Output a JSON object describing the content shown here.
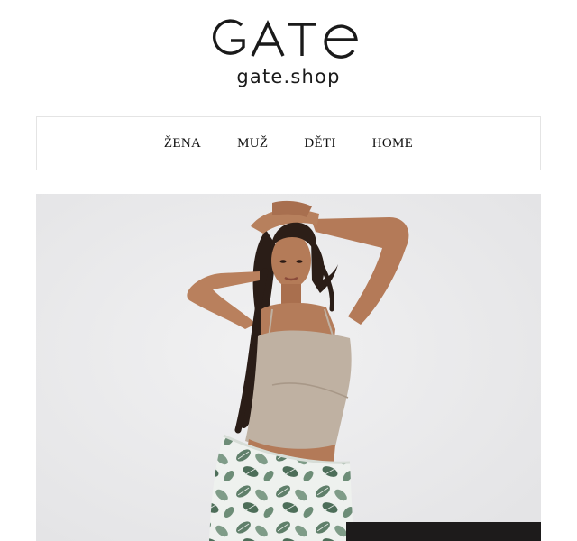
{
  "brand": {
    "logo_text": "GATE",
    "domain": "gate.shop"
  },
  "nav": {
    "items": [
      {
        "label": "ŽENA"
      },
      {
        "label": "MUŽ"
      },
      {
        "label": "DĚTI"
      },
      {
        "label": "HOME"
      }
    ]
  },
  "hero": {
    "image_subject": "model-in-beige-crop-top-and-leaf-print-skirt"
  },
  "cookie_bar": {
    "text": ""
  },
  "colors": {
    "text": "#111111",
    "nav_border": "#e4e4e4",
    "hero_background": "#ececee",
    "cookie_bar_background": "#1d1b1b"
  }
}
